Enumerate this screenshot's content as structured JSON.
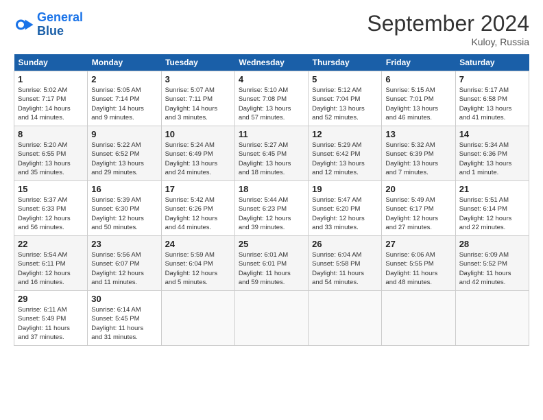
{
  "header": {
    "logo_line1": "General",
    "logo_line2": "Blue",
    "month_title": "September 2024",
    "location": "Kuloy, Russia"
  },
  "weekdays": [
    "Sunday",
    "Monday",
    "Tuesday",
    "Wednesday",
    "Thursday",
    "Friday",
    "Saturday"
  ],
  "days": [
    {
      "num": "",
      "info": ""
    },
    {
      "num": "",
      "info": ""
    },
    {
      "num": "",
      "info": ""
    },
    {
      "num": "",
      "info": ""
    },
    {
      "num": "",
      "info": ""
    },
    {
      "num": "",
      "info": ""
    },
    {
      "num": "",
      "info": ""
    },
    {
      "num": "1",
      "info": "Sunrise: 5:02 AM\nSunset: 7:17 PM\nDaylight: 14 hours\nand 14 minutes."
    },
    {
      "num": "2",
      "info": "Sunrise: 5:05 AM\nSunset: 7:14 PM\nDaylight: 14 hours\nand 9 minutes."
    },
    {
      "num": "3",
      "info": "Sunrise: 5:07 AM\nSunset: 7:11 PM\nDaylight: 14 hours\nand 3 minutes."
    },
    {
      "num": "4",
      "info": "Sunrise: 5:10 AM\nSunset: 7:08 PM\nDaylight: 13 hours\nand 57 minutes."
    },
    {
      "num": "5",
      "info": "Sunrise: 5:12 AM\nSunset: 7:04 PM\nDaylight: 13 hours\nand 52 minutes."
    },
    {
      "num": "6",
      "info": "Sunrise: 5:15 AM\nSunset: 7:01 PM\nDaylight: 13 hours\nand 46 minutes."
    },
    {
      "num": "7",
      "info": "Sunrise: 5:17 AM\nSunset: 6:58 PM\nDaylight: 13 hours\nand 41 minutes."
    },
    {
      "num": "8",
      "info": "Sunrise: 5:20 AM\nSunset: 6:55 PM\nDaylight: 13 hours\nand 35 minutes."
    },
    {
      "num": "9",
      "info": "Sunrise: 5:22 AM\nSunset: 6:52 PM\nDaylight: 13 hours\nand 29 minutes."
    },
    {
      "num": "10",
      "info": "Sunrise: 5:24 AM\nSunset: 6:49 PM\nDaylight: 13 hours\nand 24 minutes."
    },
    {
      "num": "11",
      "info": "Sunrise: 5:27 AM\nSunset: 6:45 PM\nDaylight: 13 hours\nand 18 minutes."
    },
    {
      "num": "12",
      "info": "Sunrise: 5:29 AM\nSunset: 6:42 PM\nDaylight: 13 hours\nand 12 minutes."
    },
    {
      "num": "13",
      "info": "Sunrise: 5:32 AM\nSunset: 6:39 PM\nDaylight: 13 hours\nand 7 minutes."
    },
    {
      "num": "14",
      "info": "Sunrise: 5:34 AM\nSunset: 6:36 PM\nDaylight: 13 hours\nand 1 minute."
    },
    {
      "num": "15",
      "info": "Sunrise: 5:37 AM\nSunset: 6:33 PM\nDaylight: 12 hours\nand 56 minutes."
    },
    {
      "num": "16",
      "info": "Sunrise: 5:39 AM\nSunset: 6:30 PM\nDaylight: 12 hours\nand 50 minutes."
    },
    {
      "num": "17",
      "info": "Sunrise: 5:42 AM\nSunset: 6:26 PM\nDaylight: 12 hours\nand 44 minutes."
    },
    {
      "num": "18",
      "info": "Sunrise: 5:44 AM\nSunset: 6:23 PM\nDaylight: 12 hours\nand 39 minutes."
    },
    {
      "num": "19",
      "info": "Sunrise: 5:47 AM\nSunset: 6:20 PM\nDaylight: 12 hours\nand 33 minutes."
    },
    {
      "num": "20",
      "info": "Sunrise: 5:49 AM\nSunset: 6:17 PM\nDaylight: 12 hours\nand 27 minutes."
    },
    {
      "num": "21",
      "info": "Sunrise: 5:51 AM\nSunset: 6:14 PM\nDaylight: 12 hours\nand 22 minutes."
    },
    {
      "num": "22",
      "info": "Sunrise: 5:54 AM\nSunset: 6:11 PM\nDaylight: 12 hours\nand 16 minutes."
    },
    {
      "num": "23",
      "info": "Sunrise: 5:56 AM\nSunset: 6:07 PM\nDaylight: 12 hours\nand 11 minutes."
    },
    {
      "num": "24",
      "info": "Sunrise: 5:59 AM\nSunset: 6:04 PM\nDaylight: 12 hours\nand 5 minutes."
    },
    {
      "num": "25",
      "info": "Sunrise: 6:01 AM\nSunset: 6:01 PM\nDaylight: 11 hours\nand 59 minutes."
    },
    {
      "num": "26",
      "info": "Sunrise: 6:04 AM\nSunset: 5:58 PM\nDaylight: 11 hours\nand 54 minutes."
    },
    {
      "num": "27",
      "info": "Sunrise: 6:06 AM\nSunset: 5:55 PM\nDaylight: 11 hours\nand 48 minutes."
    },
    {
      "num": "28",
      "info": "Sunrise: 6:09 AM\nSunset: 5:52 PM\nDaylight: 11 hours\nand 42 minutes."
    },
    {
      "num": "29",
      "info": "Sunrise: 6:11 AM\nSunset: 5:49 PM\nDaylight: 11 hours\nand 37 minutes."
    },
    {
      "num": "30",
      "info": "Sunrise: 6:14 AM\nSunset: 5:45 PM\nDaylight: 11 hours\nand 31 minutes."
    },
    {
      "num": "",
      "info": ""
    },
    {
      "num": "",
      "info": ""
    },
    {
      "num": "",
      "info": ""
    },
    {
      "num": "",
      "info": ""
    },
    {
      "num": "",
      "info": ""
    }
  ]
}
